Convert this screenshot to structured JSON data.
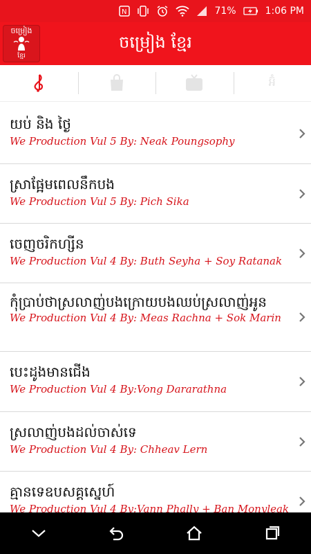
{
  "status": {
    "battery": "71%",
    "time": "1:06 PM"
  },
  "app": {
    "title": "ចម្រៀង ខ្មែរ",
    "logo_text": "ចម្រៀង",
    "logo_sub": "ខ្មែរ"
  },
  "tabs": [
    {
      "icon": "music-note-icon",
      "active": true,
      "color": "#e8141c"
    },
    {
      "icon": "shopping-bag-icon",
      "active": false
    },
    {
      "icon": "tv-icon",
      "active": false
    },
    {
      "icon": "khmer-text-icon",
      "label": "អ៊ំ",
      "active": false
    }
  ],
  "songs": [
    {
      "title": "យប់ និង ថ្ងៃ",
      "subtitle": "We Production Vul 5 By: Neak Poungsophy"
    },
    {
      "title": "ស្រាផ្អែមពេលនឹកបង",
      "subtitle": "We Production Vul 5 By: Pich Sika"
    },
    {
      "title": "ចេញចរិកហ្សីន",
      "subtitle": "We Production Vul 4 By: Buth Seyha + Soy Ratanak"
    },
    {
      "title": "កុំប្រាប់ថាស្រលាញ់បងក្រោយបងឈប់ស្រលាញ់អូន",
      "subtitle": "We Production Vul 4 By: Meas Rachna + Sok Marin"
    },
    {
      "title": "បេះដូងមានជើង",
      "subtitle": "We Production Vul 4 By:Vong Dararathna"
    },
    {
      "title": "ស្រលាញ់បងដល់ចាស់ទេ",
      "subtitle": "We Production Vul 4 By: Chheav Lern"
    },
    {
      "title": "គ្មានទេឧបសគ្គស្នេហ៍",
      "subtitle": "We Production Vul 4 By:Vann Phally + Ban Monyleak"
    }
  ]
}
